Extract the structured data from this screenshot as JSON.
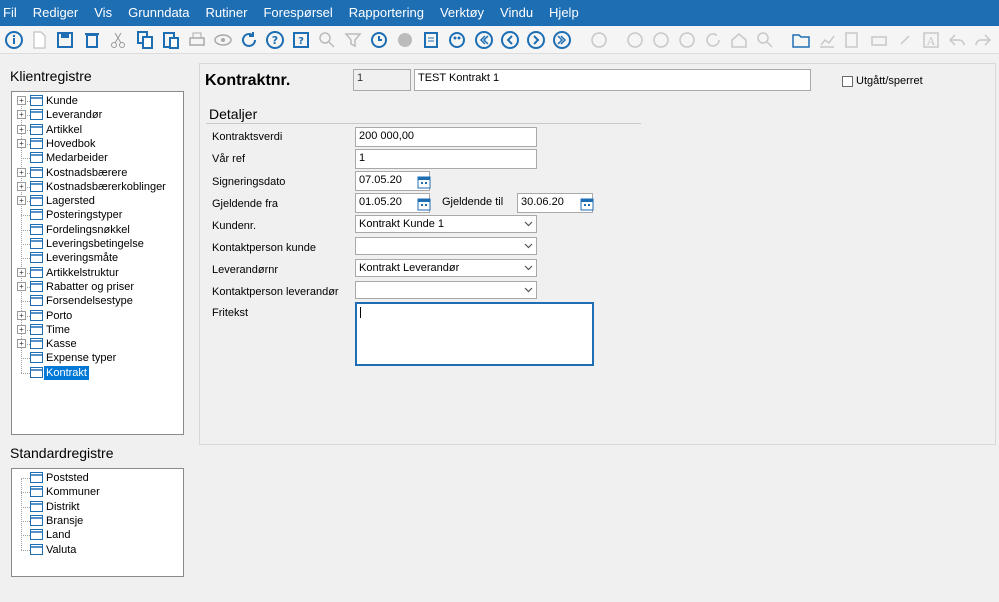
{
  "menu": [
    "Fil",
    "Rediger",
    "Vis",
    "Grunndata",
    "Rutiner",
    "Forespørsel",
    "Rapportering",
    "Verktøy",
    "Vindu",
    "Hjelp"
  ],
  "toolbar_icons": [
    "info-icon",
    "new-document-icon",
    "save-icon",
    "delete-icon",
    "cut-icon",
    "copy-icon",
    "paste-icon",
    "print-icon",
    "preview-icon",
    "refresh-icon",
    "help-icon",
    "help-context-icon",
    "search-icon",
    "filter-icon",
    "history-icon",
    "web-icon",
    "notes-icon",
    "palette-icon",
    "first-record-icon",
    "previous-record-icon",
    "next-record-icon",
    "last-record-icon",
    "query-icon",
    "back-icon",
    "forward-icon",
    "cancel-icon",
    "reload-icon",
    "home-icon",
    "zoom-icon",
    "folder-icon",
    "chart-icon",
    "approve-icon",
    "printer2-icon",
    "link-icon",
    "text-icon",
    "undo-icon",
    "redo-icon"
  ],
  "klient": {
    "title": "Klientregistre",
    "items": [
      {
        "label": "Kunde",
        "expandable": true
      },
      {
        "label": "Leverandør",
        "expandable": true
      },
      {
        "label": "Artikkel",
        "expandable": true
      },
      {
        "label": "Hovedbok",
        "expandable": true
      },
      {
        "label": "Medarbeider",
        "expandable": false
      },
      {
        "label": "Kostnadsbærere",
        "expandable": true
      },
      {
        "label": "Kostnadsbærerkoblinger",
        "expandable": true
      },
      {
        "label": "Lagersted",
        "expandable": true
      },
      {
        "label": "Posteringstyper",
        "expandable": false
      },
      {
        "label": "Fordelingsnøkkel",
        "expandable": false
      },
      {
        "label": "Leveringsbetingelse",
        "expandable": false
      },
      {
        "label": "Leveringsmåte",
        "expandable": false
      },
      {
        "label": "Artikkelstruktur",
        "expandable": true
      },
      {
        "label": "Rabatter og priser",
        "expandable": true
      },
      {
        "label": "Forsendelsestype",
        "expandable": false
      },
      {
        "label": "Porto",
        "expandable": true
      },
      {
        "label": "Time",
        "expandable": true
      },
      {
        "label": "Kasse",
        "expandable": true
      },
      {
        "label": "Expense typer",
        "expandable": false
      },
      {
        "label": "Kontrakt",
        "expandable": false,
        "selected": true
      }
    ]
  },
  "standard": {
    "title": "Standardregistre",
    "items": [
      "Poststed",
      "Kommuner",
      "Distrikt",
      "Bransje",
      "Land",
      "Valuta"
    ]
  },
  "form": {
    "heading": "Kontraktnr.",
    "contract_no": "1",
    "contract_name": "TEST Kontrakt 1",
    "blocked_label": "Utgått/sperret",
    "section": "Detaljer",
    "labels": {
      "kontraktsverdi": "Kontraktsverdi",
      "var_ref": "Vår ref",
      "signeringsdato": "Signeringsdato",
      "gjeldende_fra": "Gjeldende fra",
      "gjeldende_til": "Gjeldende til",
      "kundenr": "Kundenr.",
      "kontaktperson_kunde": "Kontaktperson kunde",
      "leverandornr": "Leverandørnr",
      "kontaktperson_leverandor": "Kontaktperson leverandør",
      "fritekst": "Fritekst"
    },
    "values": {
      "kontraktsverdi": "200 000,00",
      "var_ref": "1",
      "signeringsdato": "07.05.20",
      "gjeldende_fra": "01.05.20",
      "gjeldende_til": "30.06.20",
      "kundenr": "Kontrakt Kunde 1",
      "kontaktperson_kunde": "",
      "leverandornr": "Kontrakt Leverandør",
      "kontaktperson_leverandor": "",
      "fritekst": ""
    }
  }
}
